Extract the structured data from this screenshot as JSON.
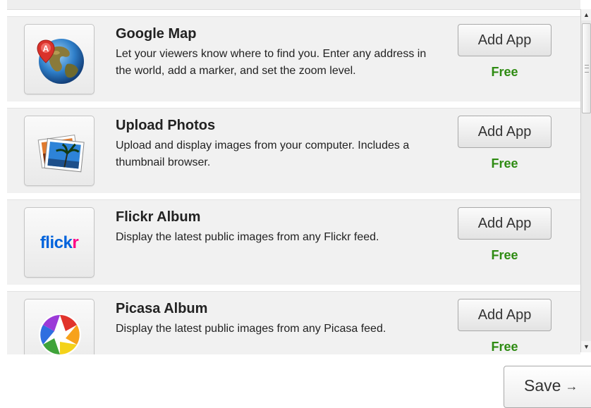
{
  "apps": [
    {
      "title": "Google Map",
      "description": "Let your viewers know where to find you. Enter any address in the world, add a marker, and set the zoom level.",
      "button_label": "Add App",
      "price": "Free",
      "icon": "globe-map-marker-icon",
      "marker_letter": "A"
    },
    {
      "title": "Upload Photos",
      "description": "Upload and display images from your computer. Includes a thumbnail browser.",
      "button_label": "Add App",
      "price": "Free",
      "icon": "photos-icon"
    },
    {
      "title": "Flickr Album",
      "description": "Display the latest public images from any Flickr feed.",
      "button_label": "Add App",
      "price": "Free",
      "icon": "flickr-logo-icon",
      "logo_text_a": "flick",
      "logo_text_b": "r"
    },
    {
      "title": "Picasa Album",
      "description": "Display the latest public images from any Picasa feed.",
      "button_label": "Add App",
      "price": "Free",
      "icon": "picasa-logo-icon"
    }
  ],
  "footer": {
    "save_label": "Save",
    "save_arrow": "→"
  },
  "scrollbar": {
    "up_arrow": "▲",
    "down_arrow": "▼"
  },
  "colors": {
    "price_green": "#2e8b12",
    "flickr_blue": "#0063dc",
    "flickr_pink": "#ff0084",
    "row_background": "#f1f1f1"
  }
}
